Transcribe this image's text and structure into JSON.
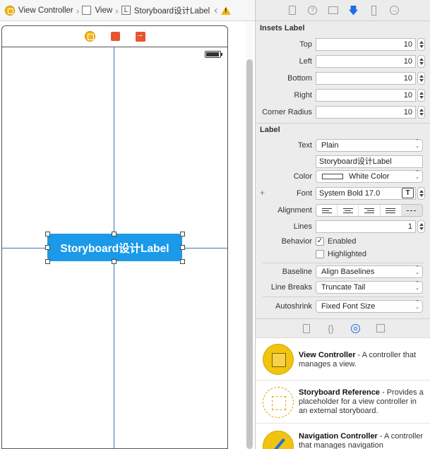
{
  "jumpbar": {
    "crumbs": [
      "View Controller",
      "View",
      "Storyboard设计Label"
    ],
    "l_glyph": "L"
  },
  "canvas": {
    "label_text": "Storyboard设计Label"
  },
  "inspector": {
    "insets": {
      "title": "Insets Label",
      "fields": [
        {
          "label": "Top",
          "value": "10"
        },
        {
          "label": "Left",
          "value": "10"
        },
        {
          "label": "Bottom",
          "value": "10"
        },
        {
          "label": "Right",
          "value": "10"
        },
        {
          "label": "Corner Radius",
          "value": "10"
        }
      ]
    },
    "label": {
      "title": "Label",
      "text_label": "Text",
      "text_type": "Plain",
      "text_value": "Storyboard设计Label",
      "color_label": "Color",
      "color_value": "White Color",
      "font_label": "Font",
      "font_value": "System Bold 17.0",
      "font_btn": "T",
      "alignment_label": "Alignment",
      "lines_label": "Lines",
      "lines_value": "1",
      "behavior_label": "Behavior",
      "enabled_label": "Enabled",
      "highlighted_label": "Highlighted",
      "enabled_mark": "✓",
      "baseline_label": "Baseline",
      "baseline_value": "Align Baselines",
      "linebreaks_label": "Line Breaks",
      "linebreaks_value": "Truncate Tail",
      "autoshrink_label": "Autoshrink",
      "autoshrink_value": "Fixed Font Size"
    }
  },
  "library": {
    "items": [
      {
        "title": "View Controller",
        "desc": " - A controller that manages a view."
      },
      {
        "title": "Storyboard Reference",
        "desc": " - Provides a placeholder for a view controller in an external storyboard."
      },
      {
        "title": "Navigation Controller",
        "desc": " - A controller that manages navigation"
      }
    ]
  }
}
